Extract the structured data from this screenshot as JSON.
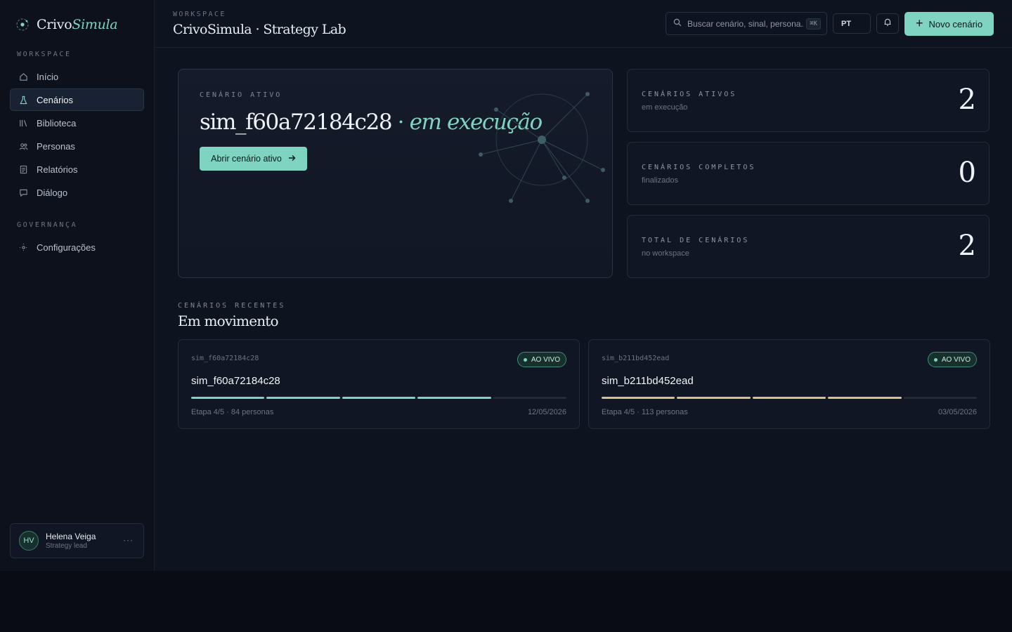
{
  "brand": {
    "name_main": "Crivo",
    "name_accent": "Simula"
  },
  "sidebar": {
    "section_workspace": "WORKSPACE",
    "items": [
      {
        "label": "Início",
        "icon": "home-icon",
        "active": false
      },
      {
        "label": "Cenários",
        "icon": "flask-icon",
        "active": true
      },
      {
        "label": "Biblioteca",
        "icon": "library-icon",
        "active": false
      },
      {
        "label": "Personas",
        "icon": "users-icon",
        "active": false
      },
      {
        "label": "Relatórios",
        "icon": "report-icon",
        "active": false
      },
      {
        "label": "Diálogo",
        "icon": "chat-icon",
        "active": false
      }
    ],
    "section_governance": "GOVERNANÇA",
    "governance_items": [
      {
        "label": "Configurações",
        "icon": "settings-icon"
      }
    ]
  },
  "user": {
    "initials": "HV",
    "name": "Helena Veiga",
    "role": "Strategy lead",
    "more": "···"
  },
  "topbar": {
    "kicker": "WORKSPACE",
    "title": "CrivoSimula · Strategy Lab",
    "search_placeholder": "Buscar cenário, sinal, persona...",
    "search_shortcut": "⌘K",
    "language": "PT",
    "new_button": "Novo cenário"
  },
  "hero": {
    "kicker": "CENÁRIO ATIVO",
    "scenario_id": "sim_f60a72184c28",
    "separator": "·",
    "status": "em execução",
    "button": "Abrir cenário ativo"
  },
  "stats": [
    {
      "label": "CENÁRIOS ATIVOS",
      "sub": "em execução",
      "value": "2"
    },
    {
      "label": "CENÁRIOS COMPLETOS",
      "sub": "finalizados",
      "value": "0"
    },
    {
      "label": "TOTAL DE CENÁRIOS",
      "sub": "no workspace",
      "value": "2"
    }
  ],
  "recent": {
    "kicker": "CENÁRIOS RECENTES",
    "title": "Em movimento",
    "cards": [
      {
        "id": "sim_f60a72184c28",
        "title": "sim_f60a72184c28",
        "badge": "AO VIVO",
        "meta": "Etapa 4/5 · 84 personas",
        "date": "12/05/2026",
        "progress_steps": 5,
        "progress_done": 4,
        "color": "#7fd3c1"
      },
      {
        "id": "sim_b211bd452ead",
        "title": "sim_b211bd452ead",
        "badge": "AO VIVO",
        "meta": "Etapa 4/5 · 113 personas",
        "date": "03/05/2026",
        "progress_steps": 5,
        "progress_done": 4,
        "color": "#d9bf8c"
      }
    ]
  },
  "colors": {
    "accent": "#7fd3c1",
    "gold": "#d9bf8c",
    "background": "#0e1320"
  }
}
